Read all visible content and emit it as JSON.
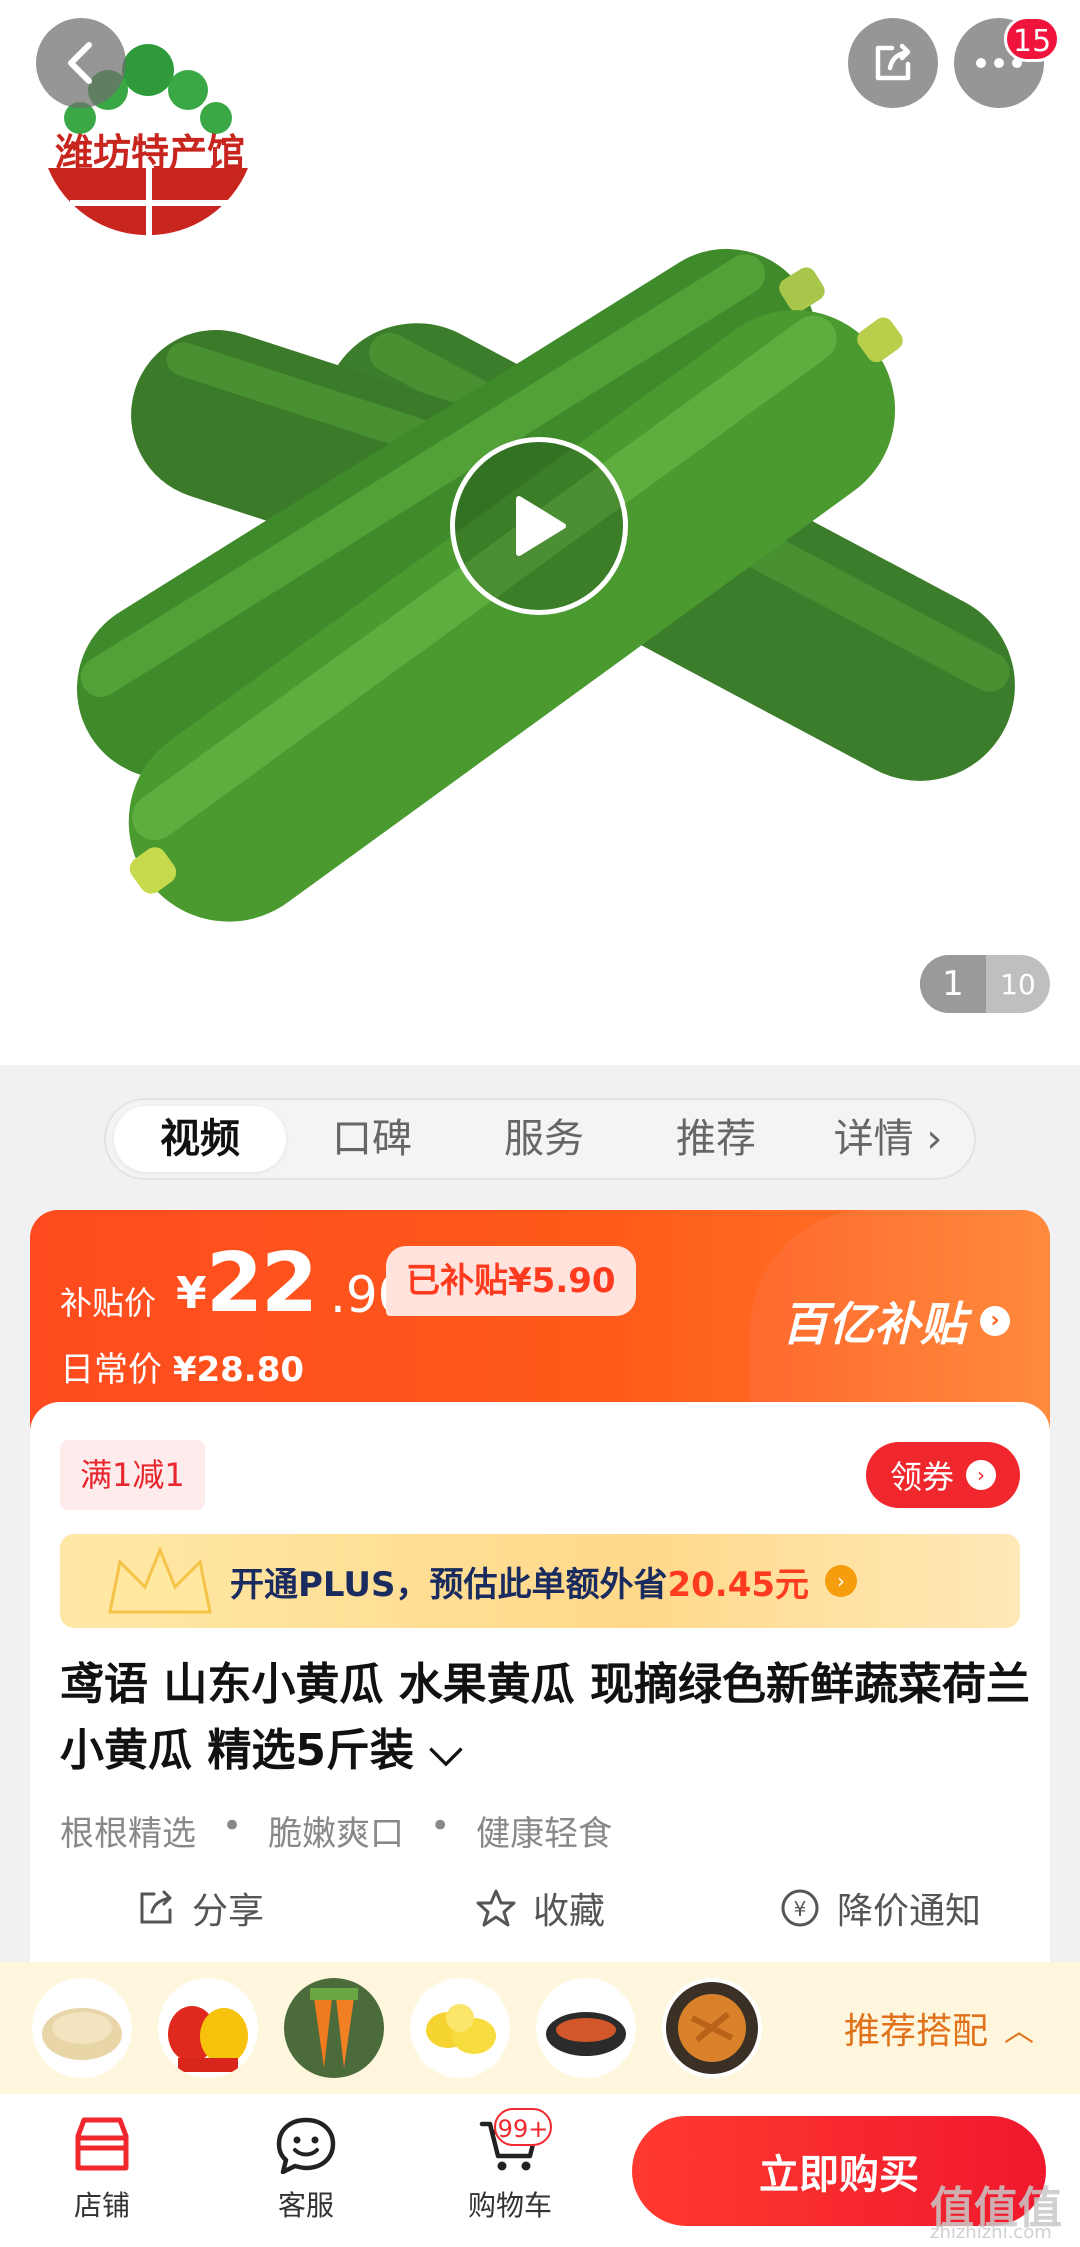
{
  "hero": {
    "store_logo_text": "潍坊特产馆",
    "notification_count": "15",
    "image_index": "1",
    "image_total": "10"
  },
  "tabs": [
    {
      "label": "视频"
    },
    {
      "label": "口碑"
    },
    {
      "label": "服务"
    },
    {
      "label": "推荐"
    },
    {
      "label": "详情 ›"
    }
  ],
  "price": {
    "subsidy_label": "补贴价",
    "currency": "¥",
    "price_int": "22",
    "price_dec": ".90",
    "subsidy_chip": "已补贴¥5.90",
    "daily_label": "日常价",
    "daily_price": "¥28.80",
    "brand_badge": "百亿补贴"
  },
  "promo": {
    "tag": "满1减1",
    "coupon": "领券",
    "plus_text_a": "开通PLUS，预估此单额外省",
    "plus_amount": "20.45元"
  },
  "product": {
    "title": "鸢语 山东小黄瓜 水果黄瓜 现摘绿色新鲜蔬菜荷兰小黄瓜 精选5斤装 ⌵",
    "features": [
      "根根精选",
      "脆嫩爽口",
      "健康轻食"
    ]
  },
  "actions": {
    "share": "分享",
    "favorite": "收藏",
    "price_alert": "降价通知"
  },
  "recommend": {
    "label": "推荐搭配",
    "items": [
      "rice-thumb",
      "pepper-thumb",
      "carrot-thumb",
      "lemon-thumb",
      "shrimp-thumb",
      "snack-thumb"
    ]
  },
  "bottom_bar": {
    "store": "店铺",
    "service": "客服",
    "cart": "购物车",
    "cart_badge": "99+",
    "buy": "立即购买"
  },
  "watermark": {
    "logo": "值值值",
    "site": "zhizhizhi.com"
  },
  "colors": {
    "accent_red": "#f0282d",
    "price_orange": "#ff5a1a",
    "plus_gold": "#ffe8a6"
  }
}
